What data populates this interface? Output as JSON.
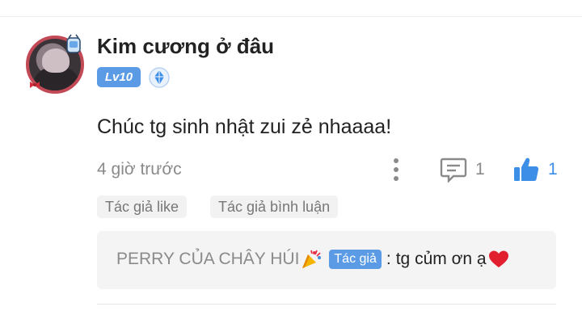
{
  "comment": {
    "username": "Kim cương ở đâu",
    "level_badge": "Lv10",
    "text": "Chúc tg sinh nhật zui zẻ nhaaaa!",
    "time": "4 giờ trước",
    "reply_count": "1",
    "like_count": "1",
    "tags": [
      "Tác giả like",
      "Tác giả bình luận"
    ],
    "icons": {
      "more": "more-vertical-icon",
      "reply": "comment-bubble-icon",
      "like": "thumbs-up-icon",
      "rank": "diamond-rank-icon"
    }
  },
  "author_reply": {
    "author": "PERRY CỦA CHÂY HÚI",
    "author_tag": "Tác giả",
    "separator": ":",
    "text": "tg củm ơn ạ",
    "emojis": [
      "party-popper-emoji",
      "red-heart-emoji"
    ]
  },
  "colors": {
    "accent": "#5b9be6",
    "like_blue": "#3d8ee6",
    "muted_text": "#8a8a8a",
    "tag_bg": "#f2f2f2",
    "reply_bg": "#f4f4f4",
    "avatar_border": "#c24a56"
  }
}
